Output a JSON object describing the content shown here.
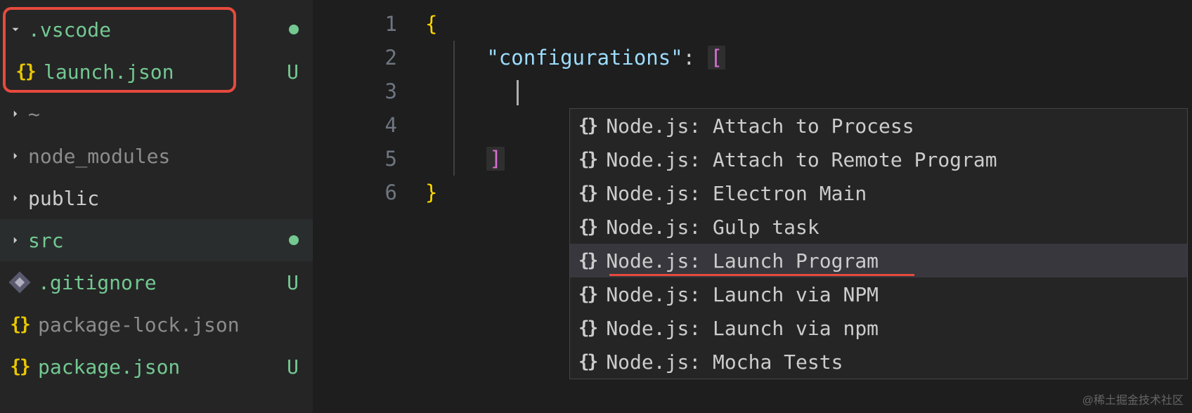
{
  "sidebar": {
    "items": [
      {
        "name": ".vscode",
        "type": "folder",
        "expanded": true,
        "color": "green",
        "status": "dot"
      },
      {
        "name": "launch.json",
        "type": "json",
        "color": "green",
        "status": "U",
        "indent": true
      },
      {
        "name": "~",
        "type": "folder",
        "expanded": false,
        "color": "dim"
      },
      {
        "name": "node_modules",
        "type": "folder",
        "expanded": false,
        "color": "dim"
      },
      {
        "name": "public",
        "type": "folder",
        "expanded": false,
        "color": "normal"
      },
      {
        "name": "src",
        "type": "folder",
        "expanded": false,
        "color": "green",
        "status": "dot",
        "selected": true
      },
      {
        "name": ".gitignore",
        "type": "gitignore",
        "color": "green",
        "status": "U"
      },
      {
        "name": "package-lock.json",
        "type": "json",
        "color": "dim"
      },
      {
        "name": "package.json",
        "type": "json",
        "color": "green",
        "status": "U"
      }
    ]
  },
  "editor": {
    "line_numbers": [
      "1",
      "2",
      "3",
      "4",
      "5",
      "6"
    ],
    "lines": {
      "l1_brace": "{",
      "l2_key": "\"configurations\"",
      "l2_colon": ":",
      "l2_bracket": "[",
      "l5_bracket": "]",
      "l6_brace": "}"
    }
  },
  "suggestions": [
    {
      "label": "Node.js: Attach to Process"
    },
    {
      "label": "Node.js: Attach to Remote Program"
    },
    {
      "label": "Node.js: Electron Main"
    },
    {
      "label": "Node.js: Gulp task"
    },
    {
      "label": "Node.js: Launch Program",
      "selected": true,
      "underline": true
    },
    {
      "label": "Node.js: Launch via NPM"
    },
    {
      "label": "Node.js: Launch via npm"
    },
    {
      "label": "Node.js: Mocha Tests"
    }
  ],
  "watermark": "@稀土掘金技术社区"
}
